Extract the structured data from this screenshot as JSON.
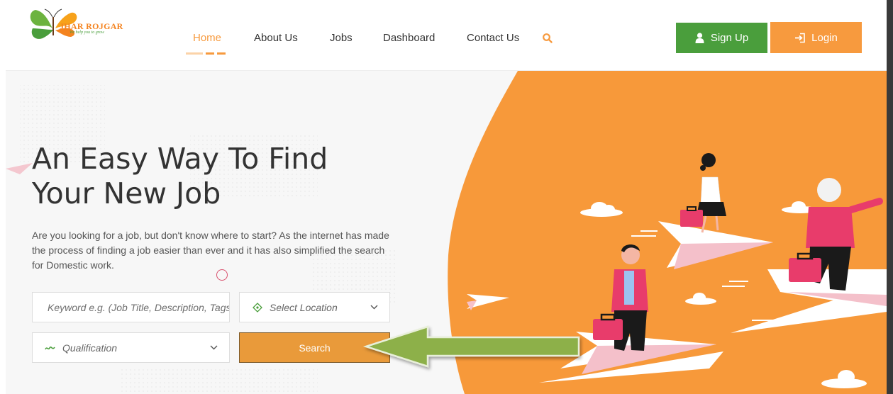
{
  "brand": {
    "name": "JHAR ROJGAR",
    "tagline": "We help you to grow"
  },
  "nav": {
    "items": [
      {
        "label": "Home",
        "active": true
      },
      {
        "label": "About Us",
        "active": false
      },
      {
        "label": "Jobs",
        "active": false
      },
      {
        "label": "Dashboard",
        "active": false
      },
      {
        "label": "Contact Us",
        "active": false
      }
    ],
    "search_icon": "search-icon"
  },
  "auth": {
    "signup_label": "Sign Up",
    "login_label": "Login"
  },
  "hero": {
    "title_line1": "An Easy Way To Find",
    "title_line2": "Your New Job",
    "description": "Are you looking for a job, but don't know where to start? As the internet has made the process of finding a job easier than ever and it has also simplified the search for Domestic work."
  },
  "search_form": {
    "keyword_placeholder": "Keyword e.g. (Job Title, Description, Tags)",
    "location_placeholder": "Select Location",
    "qualification_placeholder": "Qualification",
    "search_label": "Search"
  },
  "colors": {
    "accent": "#f79a3e",
    "signup": "#4a9e3c",
    "search_button": "#e99a3a",
    "hero_circle": "#f7993a",
    "annotation_arrow": "#8db04a"
  }
}
